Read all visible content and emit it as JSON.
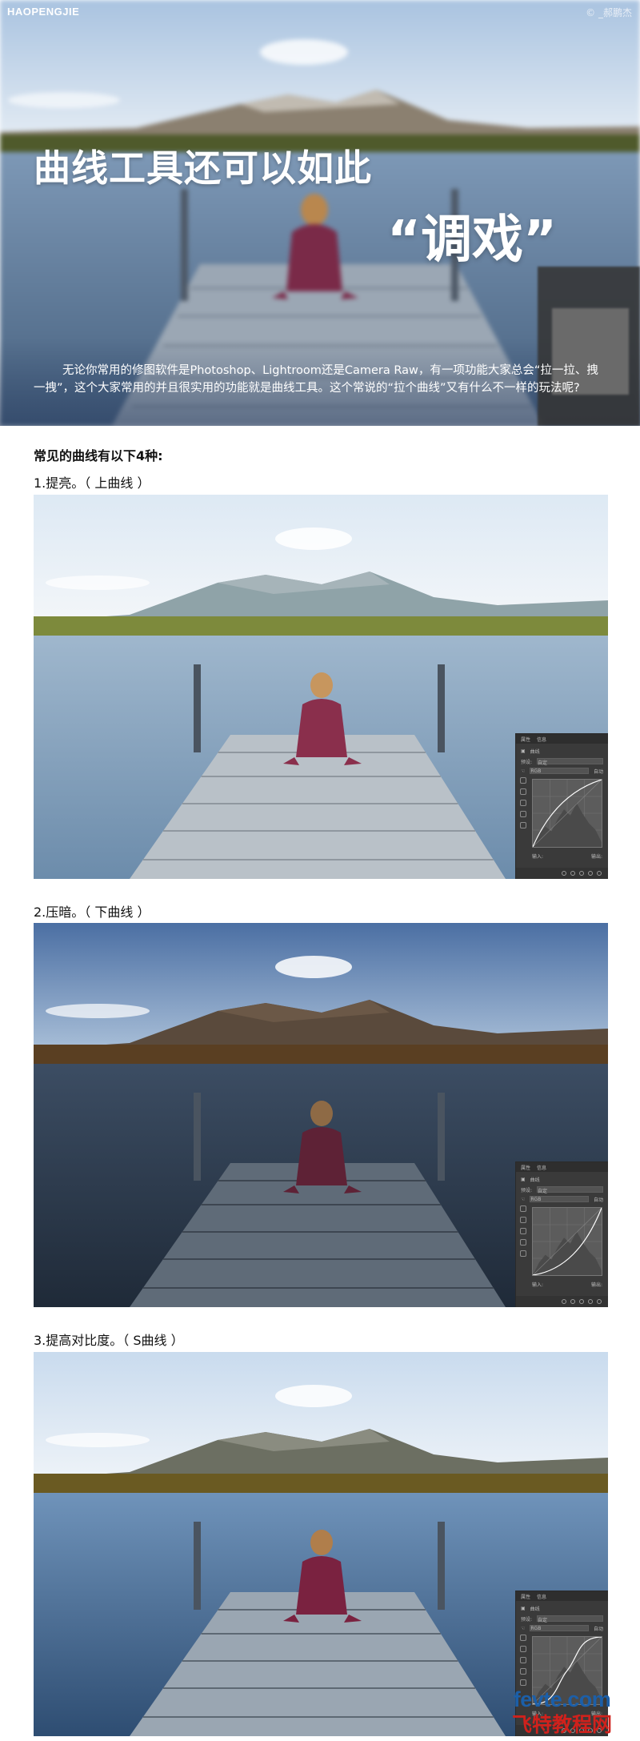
{
  "brand": {
    "left": "HAOPENGJIE",
    "right": "© _郝鹏杰"
  },
  "hero": {
    "title_line1": "曲线工具还可以如此",
    "title_line2": "“调戏”",
    "intro": "无论你常用的修图软件是Photoshop、Lightroom还是Camera Raw，有一项功能大家总会“拉一拉、拽一拽”，这个大家常用的并且很实用的功能就是曲线工具。这个常说的“拉个曲线”又有什么不一样的玩法呢?"
  },
  "section_heading": "常见的曲线有以下4种:",
  "examples": [
    {
      "caption": "1.提亮。（ 上曲线 ）",
      "tone": "bright",
      "curve": "up"
    },
    {
      "caption": "2.压暗。（ 下曲线 ）",
      "tone": "dark",
      "curve": "down"
    },
    {
      "caption": "3.提高对比度。（ S曲线 ）",
      "tone": "contrast",
      "curve": "s"
    }
  ],
  "curves_panel": {
    "tab_props": "属性",
    "tab_info": "信息",
    "title": "曲线",
    "preset_label": "预设:",
    "preset_value": "自定",
    "channel_value": "RGB",
    "auto_label": "自动",
    "input_label": "输入:",
    "output_label": "输出:"
  },
  "watermark": {
    "top": "fevte.com",
    "bottom": "飞特教程网"
  },
  "colors": {
    "bright": {
      "sky1": "#dde9f4",
      "sky2": "#f3f6f9",
      "mtn": "#8fa3a8",
      "mtn2": "#a8b6ba",
      "grass": "#7d8a3c",
      "lake1": "#9fb7cd",
      "lake2": "#6c8cab",
      "dock": "#b9c1c8",
      "plank": "#8f979f",
      "shirt": "#8a2f4c",
      "hair": "#c7965e"
    },
    "dark": {
      "sky1": "#4b6fa3",
      "sky2": "#a9bfd8",
      "mtn": "#5a4a3c",
      "mtn2": "#6d5a48",
      "grass": "#5a3f22",
      "lake1": "#3c4d63",
      "lake2": "#1f2a38",
      "dock": "#5f6b78",
      "plank": "#3d4651",
      "shirt": "#5e2236",
      "hair": "#8e6a45"
    },
    "contrast": {
      "sky1": "#c9dbee",
      "sky2": "#eef3f8",
      "mtn": "#6c6f62",
      "mtn2": "#8e8f84",
      "grass": "#6a5a22",
      "lake1": "#6f93ba",
      "lake2": "#2e4d72",
      "dock": "#9aa6b2",
      "plank": "#5d6873",
      "shirt": "#7a2240",
      "hair": "#b07e4b"
    }
  }
}
